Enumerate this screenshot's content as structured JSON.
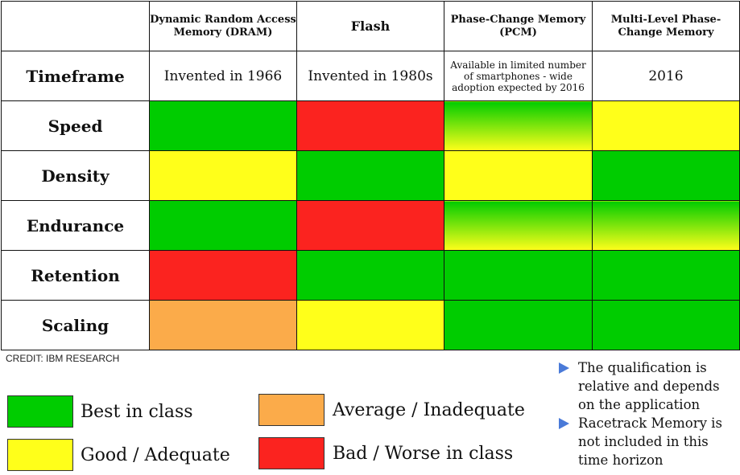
{
  "chart_data": {
    "type": "table",
    "title": "",
    "columns": [
      "Dynamic Random Access Memory (DRAM)",
      "Flash",
      "Phase-Change Memory (PCM)",
      "Multi-Level Phase-Change Memory"
    ],
    "timeframe": {
      "label": "Timeframe",
      "values": [
        "Invented in 1966",
        "Invented in 1980s",
        "Available in limited number of smartphones - wide adoption expected by 2016",
        "2016"
      ]
    },
    "rows": [
      {
        "label": "Speed",
        "ratings": [
          "best",
          "bad",
          "best-to-good",
          "good"
        ]
      },
      {
        "label": "Density",
        "ratings": [
          "good",
          "best",
          "good",
          "best"
        ]
      },
      {
        "label": "Endurance",
        "ratings": [
          "best",
          "bad",
          "best-to-good",
          "best-to-good"
        ]
      },
      {
        "label": "Retention",
        "ratings": [
          "bad",
          "best",
          "best",
          "best"
        ]
      },
      {
        "label": "Scaling",
        "ratings": [
          "average",
          "good",
          "best",
          "best"
        ]
      }
    ],
    "legend": [
      {
        "key": "best",
        "label": "Best in class",
        "color": "#00cc00"
      },
      {
        "key": "good",
        "label": "Good / Adequate",
        "color": "#ffff1a"
      },
      {
        "key": "average",
        "label": "Average / Inadequate",
        "color": "#fbab4a"
      },
      {
        "key": "bad",
        "label": "Bad / Worse in class",
        "color": "#fb231f"
      }
    ]
  },
  "credit": "CREDIT: IBM RESEARCH",
  "notes": [
    "The qualification is relative and depends on the application",
    "Racetrack Memory is not included in this time horizon"
  ]
}
